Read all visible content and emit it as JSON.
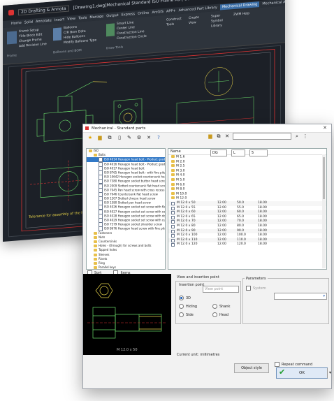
{
  "back_window": {
    "title": "[Drawing1.dwg]Mechanical Standard ISO Frame A3 [ Scale 1:1 ] - [Drawing1.dwg]",
    "workspace": "2D Drafting & Annota",
    "menu": [
      "Home",
      "Solid",
      "Annotate",
      "Insert",
      "View",
      "Tools",
      "Manage",
      "Output",
      "Express",
      "Online",
      "ArcGIS",
      "APP+",
      "Advanced Part Library",
      "Mechanical Drawing",
      "Mechanical Annota",
      "Part Library"
    ],
    "active_menu": "Mechanical Drawing",
    "ribbon_groups": [
      {
        "label": "Frame",
        "items": [
          "Frame Setup",
          "Title Block Edit",
          "Change Frame",
          "Add Revision Line"
        ]
      },
      {
        "label": "Balloons and BOM",
        "items": [
          "Balloons",
          "C/R Bom Data",
          "Hide Balloons",
          "Modify Balloons Type"
        ]
      },
      {
        "label": "Draw Tools",
        "items": [
          "Smart Line",
          "Center Line",
          "Construction Line",
          "Construction Circle"
        ]
      },
      {
        "label": "",
        "items": [
          "Construct Tools",
          "Create View",
          "Super Symbol Library",
          "ZWM Help"
        ]
      }
    ],
    "drawing_note": "Tolerance for assembly of the hole surface shall be in accordance with drawing requirements"
  },
  "dialog": {
    "title": "Mechanical - Standard parts",
    "filters": {
      "search_value": "",
      "type": "DG",
      "length_label": "L",
      "length_value": "5"
    },
    "tree": [
      {
        "label": "ISO",
        "level": 0,
        "kind": "folder"
      },
      {
        "label": "Bolts",
        "level": 1,
        "kind": "folder"
      },
      {
        "label": "ISO 4014 Hexagon head bolt - Product grade A and B",
        "level": 2,
        "kind": "doc",
        "selected": true
      },
      {
        "label": "ISO 4016 Hexagon head bolt - Product grade C",
        "level": 2,
        "kind": "doc"
      },
      {
        "label": "ISO 4017 Hexagon head bolt",
        "level": 2,
        "kind": "doc"
      },
      {
        "label": "ISO 8765 Hexagon head bolt - with fine pitch thread",
        "level": 2,
        "kind": "doc"
      },
      {
        "label": "ISO 10642 Hexagon socket countersunk head screw",
        "level": 2,
        "kind": "doc"
      },
      {
        "label": "ISO 7380 Hexagon socket button head screw",
        "level": 2,
        "kind": "doc"
      },
      {
        "label": "ISO 2009 Slotted countersunk flat head screw",
        "level": 2,
        "kind": "doc"
      },
      {
        "label": "ISO 7045 Pan head screw with cross recess",
        "level": 2,
        "kind": "doc"
      },
      {
        "label": "ISO 7046 Countersunk flat head screw",
        "level": 2,
        "kind": "doc"
      },
      {
        "label": "ISO 1207 Slotted cheese head screw",
        "level": 2,
        "kind": "doc"
      },
      {
        "label": "ISO 1580 Slotted pan head screw",
        "level": 2,
        "kind": "doc"
      },
      {
        "label": "ISO 4026 Hexagon socket set screw with flat point",
        "level": 2,
        "kind": "doc"
      },
      {
        "label": "ISO 4027 Hexagon socket set screw with cone point",
        "level": 2,
        "kind": "doc"
      },
      {
        "label": "ISO 4028 Hexagon socket set screw with dog point",
        "level": 2,
        "kind": "doc"
      },
      {
        "label": "ISO 4029 Hexagon socket set screw with cup point",
        "level": 2,
        "kind": "doc"
      },
      {
        "label": "ISO 7379 Hexagon socket shoulder screw",
        "level": 2,
        "kind": "doc"
      },
      {
        "label": "ISO 8676 Hexagon head screw with fine pitch thread",
        "level": 2,
        "kind": "doc"
      },
      {
        "label": "Fasteners",
        "level": 1,
        "kind": "folder"
      },
      {
        "label": "Nuts",
        "level": 1,
        "kind": "folder"
      },
      {
        "label": "Countersinks",
        "level": 1,
        "kind": "folder"
      },
      {
        "label": "Holes - (through) for screws and bolts",
        "level": 1,
        "kind": "folder"
      },
      {
        "label": "Tapped holes",
        "level": 1,
        "kind": "folder"
      },
      {
        "label": "Sleeves",
        "level": 1,
        "kind": "folder"
      },
      {
        "label": "Rivets",
        "level": 1,
        "kind": "folder"
      },
      {
        "label": "Ring",
        "level": 1,
        "kind": "folder"
      },
      {
        "label": "Parallel keys",
        "level": 1,
        "kind": "folder"
      },
      {
        "label": "Pins",
        "level": 1,
        "kind": "folder"
      }
    ],
    "tree_footer": {
      "sort_label": "Sort",
      "items_label": "Items"
    },
    "list": {
      "header": "Name",
      "groups": [
        "M 1.6",
        "M 2.0",
        "M 2.5",
        "M 3.0",
        "M 4.0",
        "M 5.0",
        "M 6.0",
        "M 8.0",
        "M 10.0",
        "M 12.0"
      ],
      "rows": [
        {
          "name": "M 12.0 x 50",
          "d": "12.00",
          "l": "50.0",
          "b": "18.00"
        },
        {
          "name": "M 12.0 x 55",
          "d": "12.00",
          "l": "55.0",
          "b": "18.00"
        },
        {
          "name": "M 12.0 x 60",
          "d": "12.00",
          "l": "60.0",
          "b": "18.00"
        },
        {
          "name": "M 12.0 x 65",
          "d": "12.00",
          "l": "65.0",
          "b": "18.00"
        },
        {
          "name": "M 12.0 x 70",
          "d": "12.00",
          "l": "70.0",
          "b": "18.00"
        },
        {
          "name": "M 12.0 x 80",
          "d": "12.00",
          "l": "80.0",
          "b": "18.00"
        },
        {
          "name": "M 12.0 x 90",
          "d": "12.00",
          "l": "90.0",
          "b": "18.00"
        },
        {
          "name": "M 12.0 x 100",
          "d": "12.00",
          "l": "100.0",
          "b": "18.00"
        },
        {
          "name": "M 12.0 x 110",
          "d": "12.00",
          "l": "110.0",
          "b": "18.00"
        },
        {
          "name": "M 12.0 x 120",
          "d": "12.00",
          "l": "120.0",
          "b": "18.00"
        }
      ]
    },
    "view_title": "View and insertion point",
    "insertion_point_label": "Insertion point",
    "viewpoint_placeholder": "View point",
    "radios_left": [
      {
        "label": "3D",
        "checked": true
      },
      {
        "label": "Hiding",
        "checked": false
      },
      {
        "label": "Side",
        "checked": false
      }
    ],
    "radios_right": [
      {
        "label": "Shank",
        "checked": false
      },
      {
        "label": "Head",
        "checked": false
      }
    ],
    "parameters_label": "Parameters",
    "system_label": "System",
    "current_unit": "Current unit: millimetres",
    "object_style_label": "Object style",
    "repeat_label": "Repeat command",
    "ok_label": "OK",
    "preview_caption": "M 12.0 x 50"
  },
  "colors": {
    "dialog_bg": "#f2f2f2",
    "cad_bg": "#1c2027",
    "selection": "#3178c6",
    "ok_check": "#1f9d2e"
  }
}
